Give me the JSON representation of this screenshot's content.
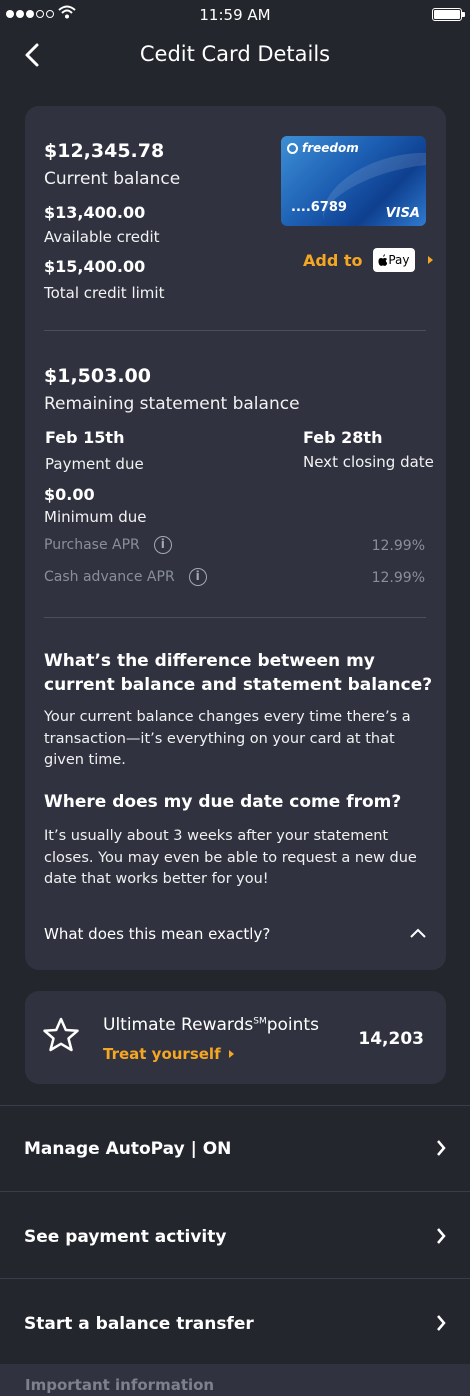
{
  "status": {
    "time": "11:59 AM"
  },
  "nav": {
    "title": "Cedit Card Details"
  },
  "summary": {
    "current_balance": "$12,345.78",
    "current_balance_label": "Current balance",
    "available_credit": "$13,400.00",
    "available_credit_label": "Available credit",
    "total_limit": "$15,400.00",
    "total_limit_label": "Total credit limit",
    "card": {
      "brand_name": "freedom",
      "number": "....6789",
      "network": "VISA",
      "colors": [
        "#3d8fd6",
        "#1b5cb0",
        "#0f3f8f"
      ]
    },
    "add_to_label": "Add to",
    "pay_label": "Pay"
  },
  "statement": {
    "remaining": "$1,503.00",
    "remaining_label": "Remaining statement balance",
    "payment_due_date": "Feb 15th",
    "payment_due_label": "Payment due",
    "closing_date": "Feb 28th",
    "closing_label": "Next closing date",
    "minimum_due": "$0.00",
    "minimum_due_label": "Minimum due",
    "purchase_apr_label": "Purchase APR",
    "purchase_apr": "12.99%",
    "cash_apr_label": "Cash advance APR",
    "cash_apr": "12.99%"
  },
  "faq": {
    "q1": "What’s the difference between my current balance and statement balance?",
    "a1": "Your current balance changes every time there’s a transaction—it’s everything on your card at that given time.",
    "q2": "Where does my due date come from?",
    "a2": "It’s usually about 3 weeks after your statement closes. You may even be able to request a new due date that works better for you!",
    "toggle_label": "What does this mean exactly?"
  },
  "rewards": {
    "title": "Ultimate Rewards",
    "superscript": "SM",
    "title_suffix": "points",
    "link": "Treat yourself",
    "points": "14,203"
  },
  "menu": [
    {
      "label": "Manage AutoPay | ON"
    },
    {
      "label": "See payment activity"
    },
    {
      "label": "Start a balance transfer"
    }
  ],
  "footer": {
    "important": "Important information"
  },
  "colors": {
    "background": "#24262e",
    "panel": "#30333f",
    "accent": "#f5a623"
  }
}
